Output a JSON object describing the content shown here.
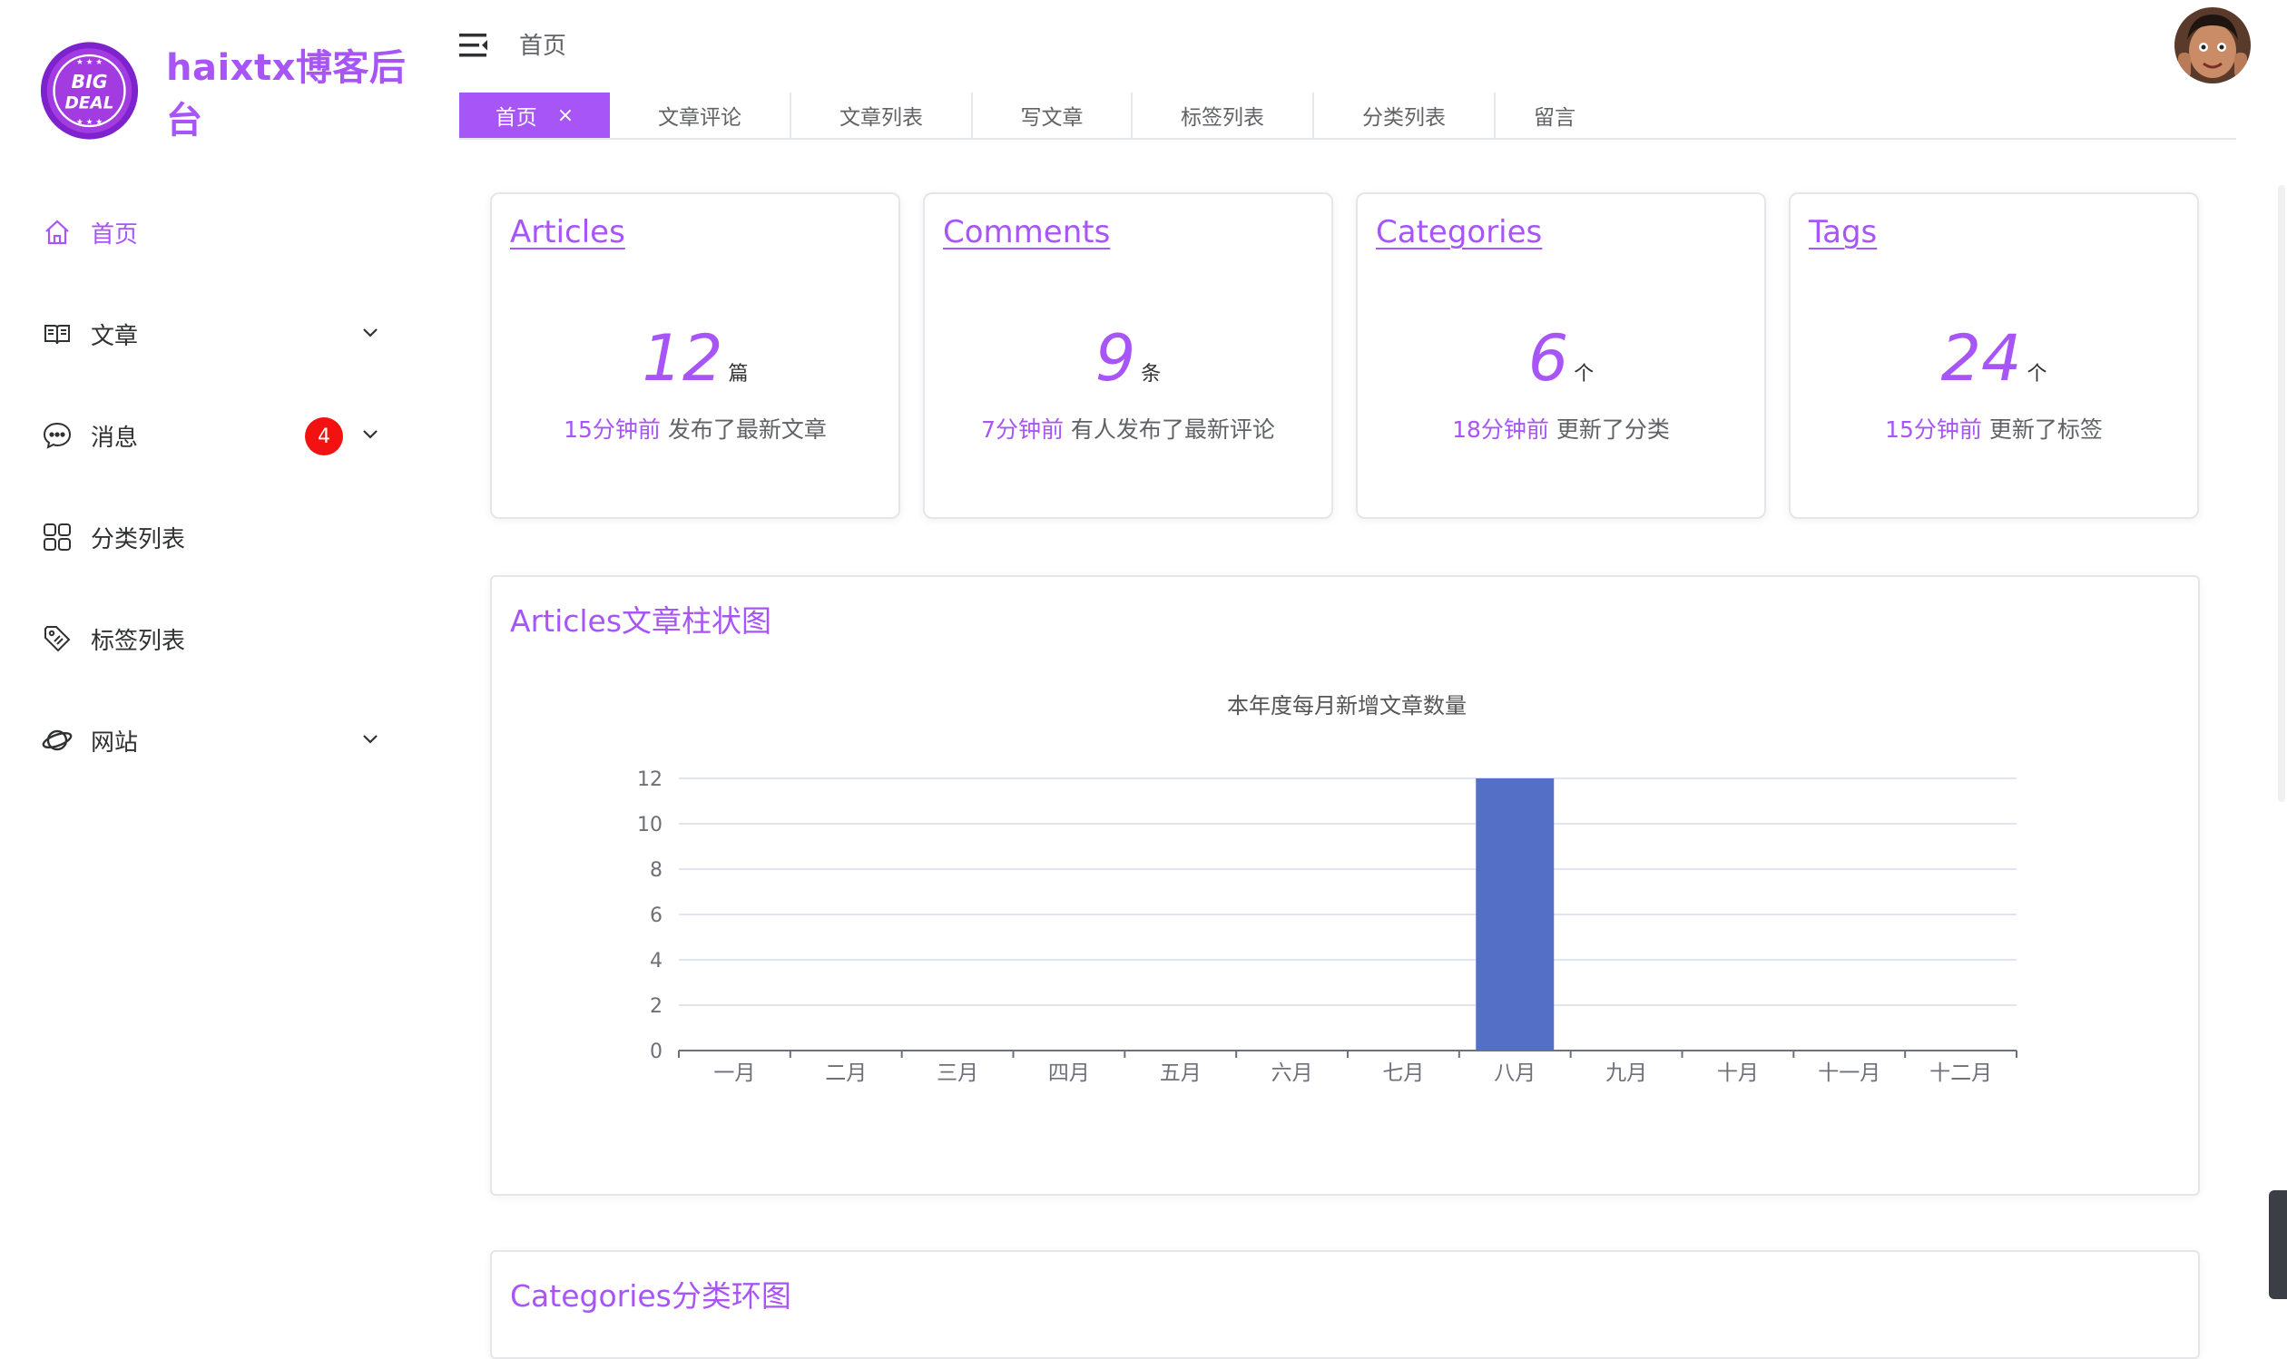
{
  "brand": {
    "title": "haixtx博客后台",
    "logo_lines": [
      "BIG",
      "DEAL"
    ],
    "accent": "#a855f7"
  },
  "sidebar": {
    "items": [
      {
        "label": "首页",
        "icon": "home-icon",
        "active": true
      },
      {
        "label": "文章",
        "icon": "book-icon",
        "expandable": true
      },
      {
        "label": "消息",
        "icon": "chat-icon",
        "expandable": true,
        "badge": "4"
      },
      {
        "label": "分类列表",
        "icon": "grid-icon"
      },
      {
        "label": "标签列表",
        "icon": "tag-icon"
      },
      {
        "label": "网站",
        "icon": "planet-icon",
        "expandable": true
      }
    ]
  },
  "header": {
    "breadcrumb": "首页"
  },
  "tabs": [
    {
      "label": "首页",
      "active": true
    },
    {
      "label": "文章评论"
    },
    {
      "label": "文章列表"
    },
    {
      "label": "写文章"
    },
    {
      "label": "标签列表"
    },
    {
      "label": "分类列表"
    },
    {
      "label": "留言"
    }
  ],
  "tab_close_glyph": "×",
  "stats": [
    {
      "title": "Articles",
      "value": "12",
      "unit": "篇",
      "time": "15分钟前",
      "desc": "发布了最新文章"
    },
    {
      "title": "Comments",
      "value": "9",
      "unit": "条",
      "time": "7分钟前",
      "desc": "有人发布了最新评论"
    },
    {
      "title": "Categories",
      "value": "6",
      "unit": "个",
      "time": "18分钟前",
      "desc": "更新了分类"
    },
    {
      "title": "Tags",
      "value": "24",
      "unit": "个",
      "time": "15分钟前",
      "desc": "更新了标签"
    }
  ],
  "panels": {
    "bar_title": "Articles文章柱状图",
    "ring_title": "Categories分类环图"
  },
  "chart_data": {
    "type": "bar",
    "title": "本年度每月新增文章数量",
    "categories": [
      "一月",
      "二月",
      "三月",
      "四月",
      "五月",
      "六月",
      "七月",
      "八月",
      "九月",
      "十月",
      "十一月",
      "十二月"
    ],
    "values": [
      0,
      0,
      0,
      0,
      0,
      0,
      0,
      12,
      0,
      0,
      0,
      0
    ],
    "ylim": [
      0,
      12
    ],
    "yticks": [
      0,
      2,
      4,
      6,
      8,
      10,
      12
    ],
    "grid": true,
    "bar_color": "#5470c6"
  }
}
